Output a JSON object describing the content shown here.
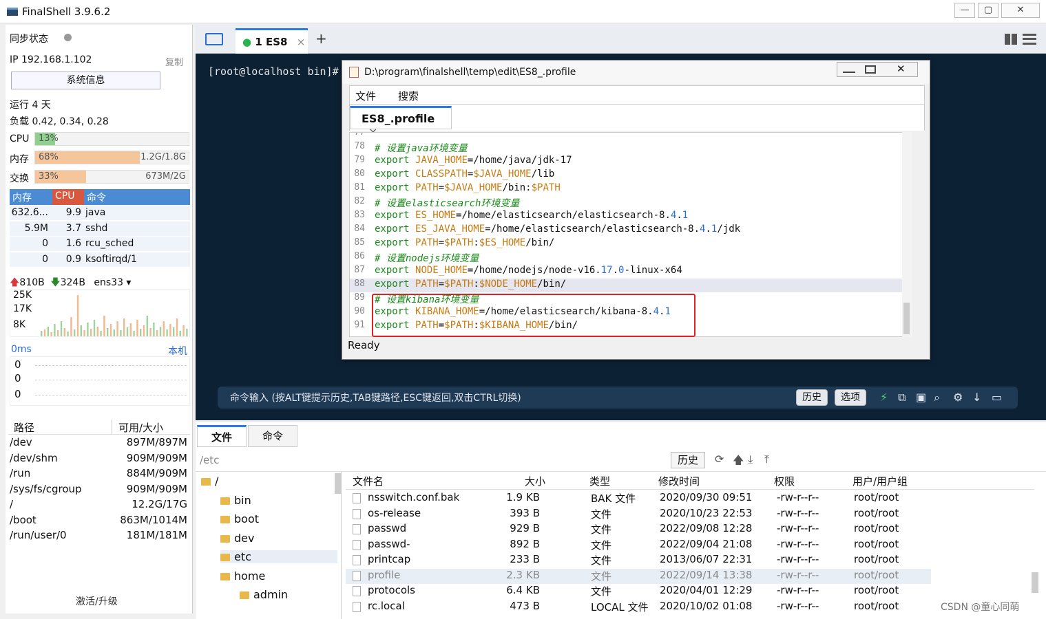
{
  "window": {
    "title": "FinalShell 3.9.6.2",
    "min": "—",
    "max": "▢",
    "close": "✕"
  },
  "left": {
    "sync_label": "同步状态",
    "ip_label": "IP 192.168.1.102",
    "copy_label": "复制",
    "sysinfo_button": "系统信息",
    "uptime": "运行 4 天",
    "load": "负载 0.42, 0.34, 0.28",
    "cpu": {
      "label": "CPU",
      "pct": "13%",
      "value": 0.13
    },
    "mem": {
      "label": "内存",
      "pct": "68%",
      "size": "1.2G/1.8G",
      "value": 0.68
    },
    "swap": {
      "label": "交换",
      "pct": "33%",
      "size": "673M/2G",
      "value": 0.33
    },
    "proc_headers": [
      "内存",
      "CPU",
      "命令"
    ],
    "procs": [
      {
        "mem": "632.6...",
        "cpu": "9.9",
        "cmd": "java"
      },
      {
        "mem": "5.9M",
        "cpu": "3.7",
        "cmd": "sshd"
      },
      {
        "mem": "0",
        "cpu": "1.6",
        "cmd": "rcu_sched"
      },
      {
        "mem": "0",
        "cpu": "0.9",
        "cmd": "ksoftirqd/1"
      }
    ],
    "net": {
      "up": "810B",
      "down": "324B",
      "iface": "ens33",
      "y_labels": [
        "25K",
        "17K",
        "8K"
      ]
    },
    "ping": {
      "label": "0ms",
      "host": "本机",
      "values": [
        "0",
        "0",
        "0"
      ]
    },
    "disk_headers": [
      "路径",
      "可用/大小"
    ],
    "disks": [
      {
        "path": "/dev",
        "size": "897M/897M"
      },
      {
        "path": "/dev/shm",
        "size": "909M/909M"
      },
      {
        "path": "/run",
        "size": "884M/909M"
      },
      {
        "path": "/sys/fs/cgroup",
        "size": "909M/909M"
      },
      {
        "path": "/",
        "size": "12.2G/17G"
      },
      {
        "path": "/boot",
        "size": "863M/1014M"
      },
      {
        "path": "/run/user/0",
        "size": "181M/181M"
      }
    ],
    "upgrade": "激活/升级"
  },
  "tabs": {
    "session": "1 ES8",
    "close": "×",
    "add": "+"
  },
  "terminal": {
    "prompt": "[root@localhost bin]#"
  },
  "editor": {
    "title": "D:\\program\\finalshell\\temp\\edit\\ES8_.profile",
    "menu": [
      "文件",
      "搜索"
    ],
    "tab": "ES8_.profile",
    "tab_close": "×",
    "status": "Ready",
    "lines": [
      {
        "n": "77",
        "parts": []
      },
      {
        "n": "78",
        "parts": [
          [
            "cm",
            "# 设置java环境变量"
          ]
        ]
      },
      {
        "n": "79",
        "parts": [
          [
            "kw",
            "export "
          ],
          [
            "vr",
            "JAVA_HOME"
          ],
          [
            "",
            "=/home/java/jdk-17"
          ]
        ]
      },
      {
        "n": "80",
        "parts": [
          [
            "kw",
            "export "
          ],
          [
            "vr",
            "CLASSPATH"
          ],
          [
            "",
            "="
          ],
          [
            "vr",
            "$JAVA_HOME"
          ],
          [
            "",
            "/lib"
          ]
        ]
      },
      {
        "n": "81",
        "parts": [
          [
            "kw",
            "export "
          ],
          [
            "vr",
            "PATH"
          ],
          [
            "",
            "="
          ],
          [
            "vr",
            "$JAVA_HOME"
          ],
          [
            "",
            "/bin:"
          ],
          [
            "vr",
            "$PATH"
          ]
        ]
      },
      {
        "n": "82",
        "parts": [
          [
            "cm",
            "# 设置elasticsearch环境变量"
          ]
        ]
      },
      {
        "n": "83",
        "parts": [
          [
            "kw",
            "export "
          ],
          [
            "vr",
            "ES_HOME"
          ],
          [
            "",
            "=/home/elasticsearch/elasticsearch-8."
          ],
          [
            "nm",
            "4"
          ],
          [
            "",
            "."
          ],
          [
            "nm",
            "1"
          ]
        ]
      },
      {
        "n": "84",
        "parts": [
          [
            "kw",
            "export "
          ],
          [
            "vr",
            "ES_JAVA_HOME"
          ],
          [
            "",
            "=/home/elasticsearch/elasticsearch-8."
          ],
          [
            "nm",
            "4"
          ],
          [
            "",
            "."
          ],
          [
            "nm",
            "1"
          ],
          [
            "",
            "/jdk"
          ]
        ]
      },
      {
        "n": "85",
        "parts": [
          [
            "kw",
            "export "
          ],
          [
            "vr",
            "PATH"
          ],
          [
            "",
            "="
          ],
          [
            "vr",
            "$PATH"
          ],
          [
            "",
            ":"
          ],
          [
            "vr",
            "$ES_HOME"
          ],
          [
            "",
            "/bin/"
          ]
        ]
      },
      {
        "n": "86",
        "parts": [
          [
            "cm",
            "# 设置nodejs环境变量"
          ]
        ]
      },
      {
        "n": "87",
        "parts": [
          [
            "kw",
            "export "
          ],
          [
            "vr",
            "NODE_HOME"
          ],
          [
            "",
            "=/home/nodejs/node-v16."
          ],
          [
            "nm",
            "17"
          ],
          [
            "",
            "."
          ],
          [
            "nm",
            "0"
          ],
          [
            "",
            "-linux-x64"
          ]
        ]
      },
      {
        "n": "88",
        "parts": [
          [
            "kw",
            "export "
          ],
          [
            "vr",
            "PATH"
          ],
          [
            "",
            "="
          ],
          [
            "vr",
            "$PATH"
          ],
          [
            "",
            ":"
          ],
          [
            "vr",
            "$NODE_HOME"
          ],
          [
            "",
            "/bin/"
          ]
        ]
      },
      {
        "n": "89",
        "parts": [
          [
            "cm",
            "# 设置kibana环境变量"
          ]
        ]
      },
      {
        "n": "90",
        "parts": [
          [
            "kw",
            "export "
          ],
          [
            "vr",
            "KIBANA_HOME"
          ],
          [
            "",
            "=/home/elasticsearch/kibana-8."
          ],
          [
            "nm",
            "4"
          ],
          [
            "",
            "."
          ],
          [
            "nm",
            "1"
          ]
        ]
      },
      {
        "n": "91",
        "parts": [
          [
            "kw",
            "export "
          ],
          [
            "vr",
            "PATH"
          ],
          [
            "",
            "="
          ],
          [
            "vr",
            "$PATH"
          ],
          [
            "",
            ":"
          ],
          [
            "vr",
            "$KIBANA_HOME"
          ],
          [
            "",
            "/bin/"
          ]
        ]
      }
    ]
  },
  "cmdbar": {
    "hint": "命令输入 (按ALT键提示历史,TAB键路径,ESC键返回,双击CTRL切换)",
    "history": "历史",
    "options": "选项"
  },
  "bottom": {
    "tabs": [
      "文件",
      "命令"
    ],
    "path": "/etc",
    "history": "历史",
    "tree": [
      {
        "name": "/",
        "lvl": 0
      },
      {
        "name": "bin",
        "lvl": 1
      },
      {
        "name": "boot",
        "lvl": 1
      },
      {
        "name": "dev",
        "lvl": 1
      },
      {
        "name": "etc",
        "lvl": 1
      },
      {
        "name": "home",
        "lvl": 1
      },
      {
        "name": "admin",
        "lvl": 2
      }
    ],
    "file_headers": [
      "文件名",
      "大小",
      "类型",
      "修改时间",
      "权限",
      "用户/用户组"
    ],
    "files": [
      {
        "name": "nsswitch.conf.bak",
        "size": "1.9 KB",
        "type": "BAK 文件",
        "mtime": "2020/09/30 09:51",
        "perm": "-rw-r--r--",
        "owner": "root/root"
      },
      {
        "name": "os-release",
        "size": "393 B",
        "type": "文件",
        "mtime": "2020/10/23 22:53",
        "perm": "-rw-r--r--",
        "owner": "root/root"
      },
      {
        "name": "passwd",
        "size": "929 B",
        "type": "文件",
        "mtime": "2022/09/08 12:28",
        "perm": "-rw-r--r--",
        "owner": "root/root"
      },
      {
        "name": "passwd-",
        "size": "892 B",
        "type": "文件",
        "mtime": "2022/09/04 21:08",
        "perm": "-rw-r--r--",
        "owner": "root/root"
      },
      {
        "name": "printcap",
        "size": "233 B",
        "type": "文件",
        "mtime": "2013/06/07 22:31",
        "perm": "-rw-r--r--",
        "owner": "root/root"
      },
      {
        "name": "profile",
        "size": "2.3 KB",
        "type": "文件",
        "mtime": "2022/09/14 13:38",
        "perm": "-rw-r--r--",
        "owner": "root/root"
      },
      {
        "name": "protocols",
        "size": "6.4 KB",
        "type": "文件",
        "mtime": "2020/04/01 12:29",
        "perm": "-rw-r--r--",
        "owner": "root/root"
      },
      {
        "name": "rc.local",
        "size": "473 B",
        "type": "LOCAL 文件",
        "mtime": "2020/10/02 01:08",
        "perm": "-rw-r--r--",
        "owner": "root/root"
      }
    ]
  },
  "watermark": "CSDN @童心同萌"
}
